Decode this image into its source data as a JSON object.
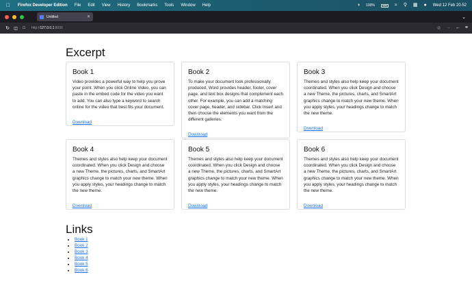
{
  "menubar": {
    "app_name": "Firefox Developer Edition",
    "menus": [
      "File",
      "Edit",
      "View",
      "History",
      "Bookmarks",
      "Tools",
      "Window",
      "Help"
    ],
    "battery": "100%",
    "datetime": "Wed 12 Feb  20.52"
  },
  "browser": {
    "tab_title": "Untitled",
    "url_protocol": "http://",
    "url_host": "127.0.0.1",
    "url_port": ":8000"
  },
  "page": {
    "excerpt_heading": "Excerpt",
    "links_heading": "Links",
    "download_label": "Download",
    "books": [
      {
        "title": "Book 1",
        "text": "Video provides a powerful way to help you prove your point. When you click Online Video, you can paste in the embed code for the video you want to add. You can also type a keyword to search online for the video that best fits your document."
      },
      {
        "title": "Book 2",
        "text": "To make your document look professionally produced, Word provides header, footer, cover page, and text box designs that complement each other. For example, you can add a matching cover page, header, and sidebar. Click Insert and then choose the elements you want from the different galleries."
      },
      {
        "title": "Book 3",
        "text": "Themes and styles also help keep your document coordinated. When you click Design and choose a new Theme, the pictures, charts, and SmartArt graphics change to match your new theme. When you apply styles, your headings change to match the new theme."
      },
      {
        "title": "Book 4",
        "text": "Themes and styles also help keep your document coordinated. When you click Design and choose a new Theme, the pictures, charts, and SmartArt graphics change to match your new theme. When you apply styles, your headings change to match the new theme."
      },
      {
        "title": "Book 5",
        "text": "Themes and styles also help keep your document coordinated. When you click Design and choose a new Theme, the pictures, charts, and SmartArt graphics change to match your new theme. When you apply styles, your headings change to match the new theme."
      },
      {
        "title": "Book 6",
        "text": "Themes and styles also help keep your document coordinated. When you click Design and choose a new Theme, the pictures, charts, and SmartArt graphics change to match your new theme. When you apply styles, your headings change to match the new theme."
      }
    ],
    "links": [
      "Book 1",
      "Book 2",
      "Book 3",
      "Book 4",
      "Book 5",
      "Book 6"
    ]
  }
}
